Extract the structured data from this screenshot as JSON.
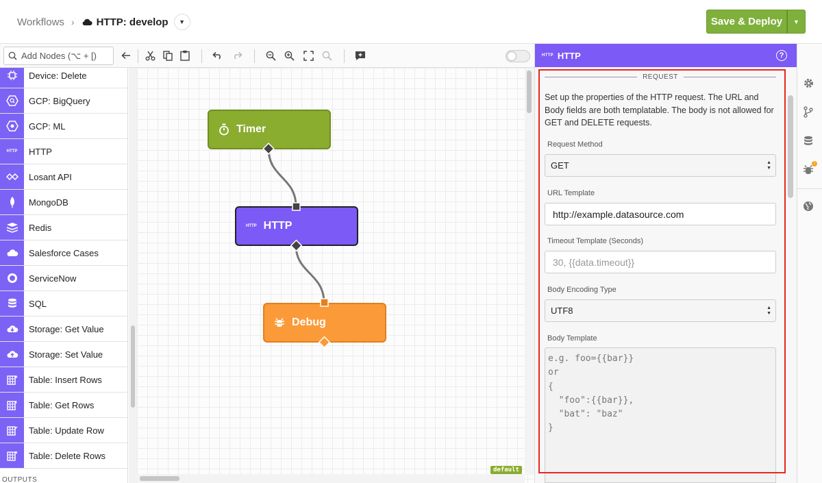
{
  "header": {
    "breadcrumb_root": "Workflows",
    "breadcrumb_sep": "›",
    "workflow_name": "HTTP: develop",
    "deploy_label": "Save & Deploy"
  },
  "toolbar": {
    "search_placeholder": "Add Nodes (⌥ + [)",
    "icons": [
      "collapse-arrow-icon",
      "cut-icon",
      "copy-icon",
      "paste-icon",
      "undo-icon",
      "redo-icon",
      "zoom-out-icon",
      "zoom-in-icon",
      "fit-icon",
      "zoom-reset-icon",
      "comment-icon"
    ]
  },
  "palette": {
    "items": [
      {
        "label": "Device: Delete",
        "icon": "device-icon"
      },
      {
        "label": "GCP: BigQuery",
        "icon": "gcp-bigquery-icon"
      },
      {
        "label": "GCP: ML",
        "icon": "gcp-ml-icon"
      },
      {
        "label": "HTTP",
        "icon": "http-icon"
      },
      {
        "label": "Losant API",
        "icon": "losant-icon"
      },
      {
        "label": "MongoDB",
        "icon": "mongodb-icon"
      },
      {
        "label": "Redis",
        "icon": "redis-icon"
      },
      {
        "label": "Salesforce Cases",
        "icon": "salesforce-icon"
      },
      {
        "label": "ServiceNow",
        "icon": "servicenow-icon"
      },
      {
        "label": "SQL",
        "icon": "database-icon"
      },
      {
        "label": "Storage: Get Value",
        "icon": "cloud-download-icon"
      },
      {
        "label": "Storage: Set Value",
        "icon": "cloud-upload-icon"
      },
      {
        "label": "Table: Insert Rows",
        "icon": "table-icon"
      },
      {
        "label": "Table: Get Rows",
        "icon": "table-icon"
      },
      {
        "label": "Table: Update Row",
        "icon": "table-icon"
      },
      {
        "label": "Table: Delete Rows",
        "icon": "table-icon"
      }
    ],
    "outputs_label": "OUTPUTS"
  },
  "canvas": {
    "nodes": {
      "timer": "Timer",
      "http": "HTTP",
      "debug": "Debug"
    },
    "branch_tag": "default"
  },
  "panel": {
    "header_icon_text": "HTTP",
    "title": "HTTP",
    "help": "?",
    "section_title": "REQUEST",
    "description": "Set up the properties of the HTTP request. The URL and Body fields are both templatable. The body is not allowed for GET and DELETE requests.",
    "request_method": {
      "label": "Request Method",
      "value": "GET"
    },
    "url_template": {
      "label": "URL Template",
      "value": "http://example.datasource.com"
    },
    "timeout_template": {
      "label": "Timeout Template (Seconds)",
      "placeholder": "30, {{data.timeout}}"
    },
    "body_encoding": {
      "label": "Body Encoding Type",
      "value": "UTF8"
    },
    "body_template": {
      "label": "Body Template",
      "placeholder": "e.g. foo={{bar}}\nor\n{\n  \"foo\":{{bar}},\n  \"bat\": \"baz\"\n}"
    }
  },
  "colors": {
    "accent": "#7b5af5",
    "deploy": "#7fb03c",
    "timer_node": "#8aac2f",
    "debug_node": "#fb9a38",
    "highlight": "#e8261c"
  }
}
